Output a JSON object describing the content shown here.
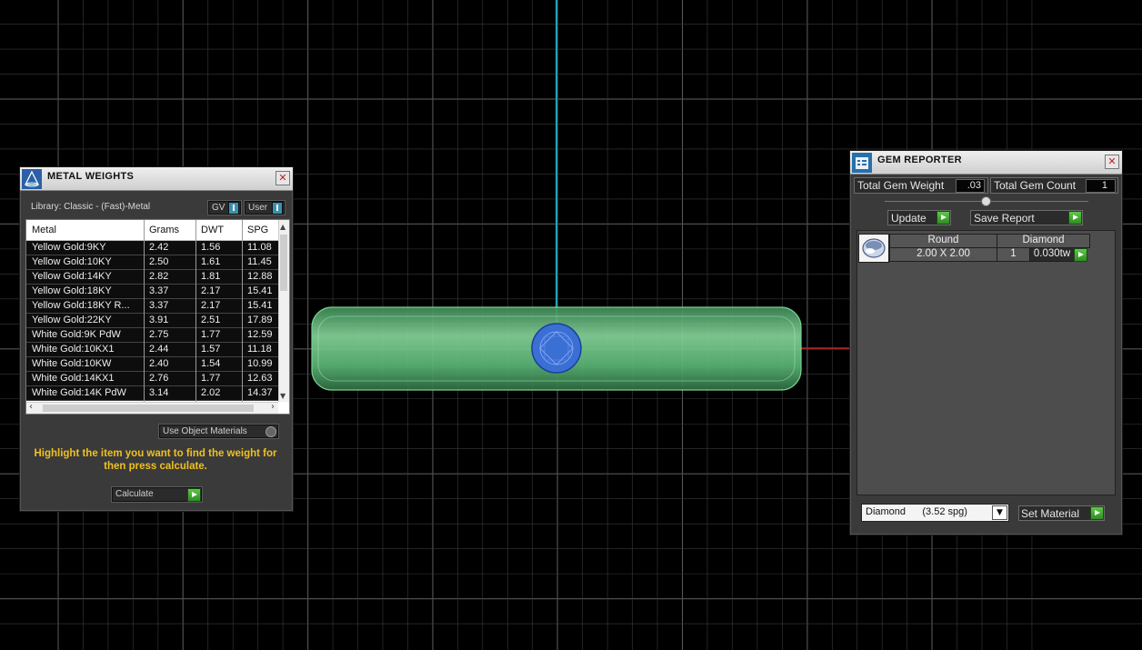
{
  "metal_weights": {
    "title": "METAL WEIGHTS",
    "library": "Library: Classic - (Fast)-Metal",
    "gv_label": "GV",
    "user_label": "User",
    "columns": [
      "Metal",
      "Grams",
      "DWT",
      "SPG"
    ],
    "rows": [
      {
        "metal": "Yellow Gold:9KY",
        "grams": "2.42",
        "dwt": "1.56",
        "spg": "11.08"
      },
      {
        "metal": "Yellow Gold:10KY",
        "grams": "2.50",
        "dwt": "1.61",
        "spg": "11.45"
      },
      {
        "metal": "Yellow Gold:14KY",
        "grams": "2.82",
        "dwt": "1.81",
        "spg": "12.88"
      },
      {
        "metal": "Yellow Gold:18KY",
        "grams": "3.37",
        "dwt": "2.17",
        "spg": "15.41"
      },
      {
        "metal": "Yellow Gold:18KY R...",
        "grams": "3.37",
        "dwt": "2.17",
        "spg": "15.41"
      },
      {
        "metal": "Yellow Gold:22KY",
        "grams": "3.91",
        "dwt": "2.51",
        "spg": "17.89"
      },
      {
        "metal": "White Gold:9K PdW",
        "grams": "2.75",
        "dwt": "1.77",
        "spg": "12.59"
      },
      {
        "metal": "White Gold:10KX1",
        "grams": "2.44",
        "dwt": "1.57",
        "spg": "11.18"
      },
      {
        "metal": "White Gold:10KW",
        "grams": "2.40",
        "dwt": "1.54",
        "spg": "10.99"
      },
      {
        "metal": "White Gold:14KX1",
        "grams": "2.76",
        "dwt": "1.77",
        "spg": "12.63"
      },
      {
        "metal": "White Gold:14K PdW",
        "grams": "3.14",
        "dwt": "2.02",
        "spg": "14.37"
      }
    ],
    "use_object_materials": "Use Object Materials",
    "hint": "Highlight the item you want to find the weight for then press calculate.",
    "calculate_label": "Calculate"
  },
  "gem_reporter": {
    "title": "GEM REPORTER",
    "total_weight_label": "Total Gem Weight",
    "total_weight_value": ".03",
    "total_count_label": "Total Gem Count",
    "total_count_value": "1",
    "update_label": "Update",
    "save_report_label": "Save Report",
    "gem": {
      "shape": "Round",
      "type": "Diamond",
      "size": "2.00 X 2.00",
      "count": "1",
      "weight": "0.030tw"
    },
    "material_select": "Diamond      (3.52 spg)",
    "set_material_label": "Set Material"
  },
  "colors": {
    "grid_line": "#8a8a8a",
    "axis_vertical": "#1fa3b8",
    "axis_horizontal": "#c02020",
    "ring_fill": "#5db878",
    "stone": "#3a6fd4",
    "hint_text": "#f0c020",
    "play_button": "#3fae32"
  },
  "icons": [
    "metal-weights-icon",
    "gem-reporter-icon",
    "close-icon",
    "play-icon",
    "toggle-icon",
    "dropdown-arrow-icon",
    "gem-thumbnail-icon"
  ]
}
